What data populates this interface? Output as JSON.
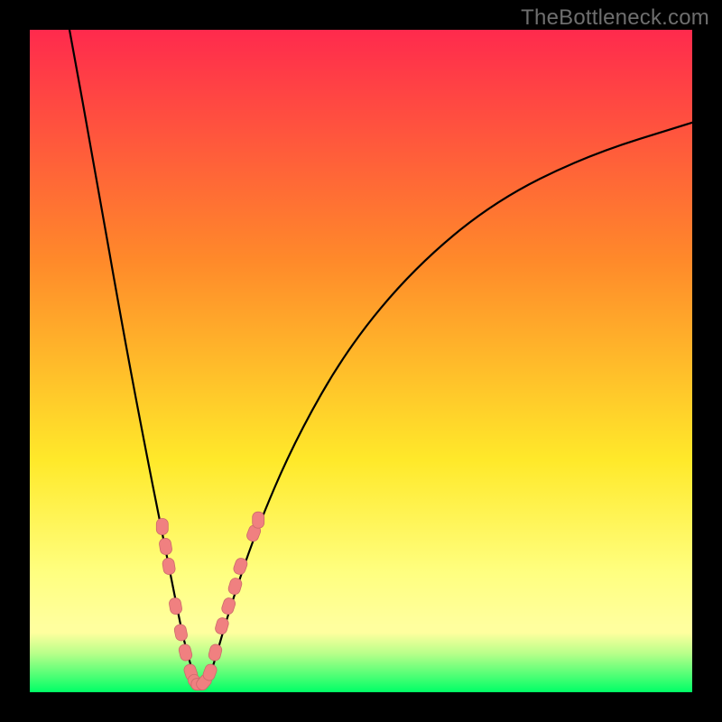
{
  "watermark": "TheBottleneck.com",
  "colors": {
    "black": "#000000",
    "curve": "#000000",
    "marker_fill": "#f08080",
    "marker_stroke": "#cc6a6a",
    "gradient_top": "#ff2a4d",
    "gradient_mid1": "#ff8a2a",
    "gradient_mid2": "#ffe92a",
    "gradient_mid3": "#ffff80",
    "gradient_bottom_yellow": "#ffff9e",
    "green_top": "#b8ff8a",
    "green_bottom": "#00ff66"
  },
  "chart_data": {
    "type": "line",
    "title": "",
    "xlabel": "",
    "ylabel": "",
    "xlim": [
      0,
      100
    ],
    "ylim": [
      0,
      100
    ],
    "note": "Axes are unlabeled in the source image; x is implicit horizontal parameter, y is the curve height as a percentage of plot height (0 at bottom, 100 at top).",
    "series": [
      {
        "name": "bottleneck-curve",
        "x": [
          6,
          10,
          14,
          18,
          20,
          22,
          23,
          24,
          25,
          26,
          27,
          28,
          30,
          34,
          40,
          48,
          58,
          70,
          84,
          100
        ],
        "y": [
          100,
          78,
          55,
          34,
          24,
          14,
          9,
          5,
          2,
          1,
          2,
          5,
          12,
          24,
          38,
          52,
          64,
          74,
          81,
          86
        ]
      }
    ],
    "markers": {
      "name": "highlighted-points",
      "note": "Pink rounded markers overlaid on the curve near the valley region.",
      "points": [
        {
          "x": 20.0,
          "y": 25
        },
        {
          "x": 20.5,
          "y": 22
        },
        {
          "x": 21.0,
          "y": 19
        },
        {
          "x": 22.0,
          "y": 13
        },
        {
          "x": 22.8,
          "y": 9
        },
        {
          "x": 23.5,
          "y": 6
        },
        {
          "x": 24.3,
          "y": 3
        },
        {
          "x": 25.0,
          "y": 1.5
        },
        {
          "x": 25.6,
          "y": 1.2
        },
        {
          "x": 26.3,
          "y": 1.5
        },
        {
          "x": 27.2,
          "y": 3
        },
        {
          "x": 28.0,
          "y": 6
        },
        {
          "x": 29.0,
          "y": 10
        },
        {
          "x": 30.0,
          "y": 13
        },
        {
          "x": 31.0,
          "y": 16
        },
        {
          "x": 31.8,
          "y": 19
        },
        {
          "x": 33.8,
          "y": 24
        },
        {
          "x": 34.5,
          "y": 26
        }
      ]
    },
    "bands": {
      "green_band_top_pct": 91,
      "green_band_bottom_pct": 100
    }
  }
}
